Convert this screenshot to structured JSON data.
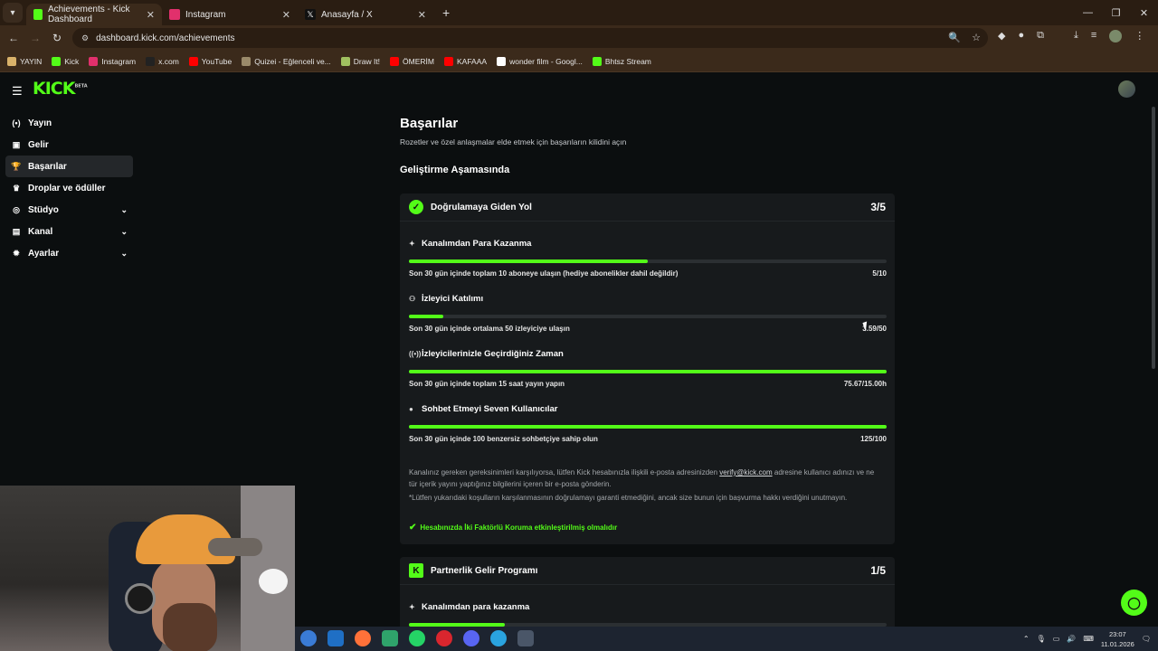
{
  "browser": {
    "tabs": [
      {
        "title": "Achievements - Kick Dashboard",
        "color": "#53fc18",
        "active": true
      },
      {
        "title": "Instagram",
        "color": "#e1306c",
        "active": false
      },
      {
        "title": "Anasayfa / X",
        "color": "#111111",
        "active": false
      }
    ],
    "url": "dashboard.kick.com/achievements",
    "bookmarks": [
      {
        "label": "YAYIN",
        "icon": "folder-icon",
        "color": "#d9b26a"
      },
      {
        "label": "Kick",
        "icon": "kick-icon",
        "color": "#53fc18"
      },
      {
        "label": "Instagram",
        "icon": "instagram-icon",
        "color": "#e1306c"
      },
      {
        "label": "x.com",
        "icon": "x-icon",
        "color": "#222222"
      },
      {
        "label": "YouTube",
        "icon": "youtube-icon",
        "color": "#ff0000"
      },
      {
        "label": "Quizei - Eğlenceli ve...",
        "icon": "quizei-icon",
        "color": "#9a8a6a"
      },
      {
        "label": "Draw It!",
        "icon": "drawit-icon",
        "color": "#a0c060"
      },
      {
        "label": "ÖMERİM",
        "icon": "youtube-icon",
        "color": "#ff0000"
      },
      {
        "label": "KAFAAA",
        "icon": "youtube-icon",
        "color": "#ff0000"
      },
      {
        "label": "wonder film - Googl...",
        "icon": "google-icon",
        "color": "#ffffff"
      },
      {
        "label": "Bhtsz Stream",
        "icon": "kick-icon",
        "color": "#53fc18"
      }
    ]
  },
  "brand": {
    "logo": "KICK",
    "logo_sup": "BETA",
    "accent": "#53fc18"
  },
  "sidebar": {
    "items": [
      {
        "label": "Yayın",
        "icon": "broadcast-icon",
        "glyph": "(•)",
        "active": false,
        "chevron": false
      },
      {
        "label": "Gelir",
        "icon": "revenue-icon",
        "glyph": "▣",
        "active": false,
        "chevron": false
      },
      {
        "label": "Başarılar",
        "icon": "trophy-icon",
        "glyph": "🏆",
        "active": true,
        "chevron": false
      },
      {
        "label": "Droplar ve ödüller",
        "icon": "gift-icon",
        "glyph": "♛",
        "active": false,
        "chevron": false
      },
      {
        "label": "Stüdyo",
        "icon": "studio-icon",
        "glyph": "◎",
        "active": false,
        "chevron": true
      },
      {
        "label": "Kanal",
        "icon": "channel-icon",
        "glyph": "▤",
        "active": false,
        "chevron": true
      },
      {
        "label": "Ayarlar",
        "icon": "settings-icon",
        "glyph": "✹",
        "active": false,
        "chevron": true
      }
    ]
  },
  "main": {
    "title": "Başarılar",
    "subtitle": "Rozetler ve özel anlaşmalar elde etmek için başarıların kilidini açın",
    "section": "Geliştirme Aşamasında"
  },
  "cards": [
    {
      "title": "Doğrulamaya Giden Yol",
      "count": "3/5",
      "requirements": [
        {
          "title": "Kanalımdan Para Kazanma",
          "icon": "sparkle-icon",
          "glyph": "✦",
          "desc": "Son 30 gün içinde toplam 10 aboneye ulaşın (hediye abonelikler dahil değildir)",
          "value": "5/10",
          "progress": 0.5
        },
        {
          "title": "İzleyici Katılımı",
          "icon": "viewers-icon",
          "glyph": "⚇",
          "desc": "Son 30 gün içinde ortalama 50 izleyiciye ulaşın",
          "value": "3.59/50",
          "progress": 0.072
        },
        {
          "title": "İzleyicilerinizle Geçirdiğiniz Zaman",
          "icon": "broadcast-icon",
          "glyph": "((•))",
          "desc": "Son 30 gün içinde toplam 15 saat yayın yapın",
          "value": "75.67/15.00h",
          "progress": 1.0
        },
        {
          "title": "Sohbet Etmeyi Seven Kullanıcılar",
          "icon": "chat-icon",
          "glyph": "●",
          "desc": "Son 30 gün içinde 100 benzersiz sohbetçiye sahip olun",
          "value": "125/100",
          "progress": 1.0
        }
      ],
      "note_prefix": "Kanalınız gereken gereksinimleri karşılıyorsa, lütfen Kick hesabınızla ilişkili e-posta adresinizden ",
      "note_email": "verify@kick.com",
      "note_suffix": " adresine kullanıcı adınızı ve ne tür içerik yayını yaptığınız bilgilerini içeren bir e-posta gönderin.",
      "note2": "*Lütfen yukarıdaki koşulların karşılanmasının doğrulamayı garanti etmediğini, ancak size bunun için başvurma hakkı verdiğini unutmayın.",
      "tfa": "Hesabınızda İki Faktörlü Koruma etkinleştirilmiş olmalıdır"
    },
    {
      "title": "Partnerlik Gelir Programı",
      "count": "1/5",
      "requirements": [
        {
          "title": "Kanalımdan para kazanma",
          "icon": "sparkle-icon",
          "glyph": "✦",
          "progress": 0.2
        }
      ]
    }
  ],
  "taskbar": {
    "time": "23:07",
    "date": "11.01.2026"
  }
}
